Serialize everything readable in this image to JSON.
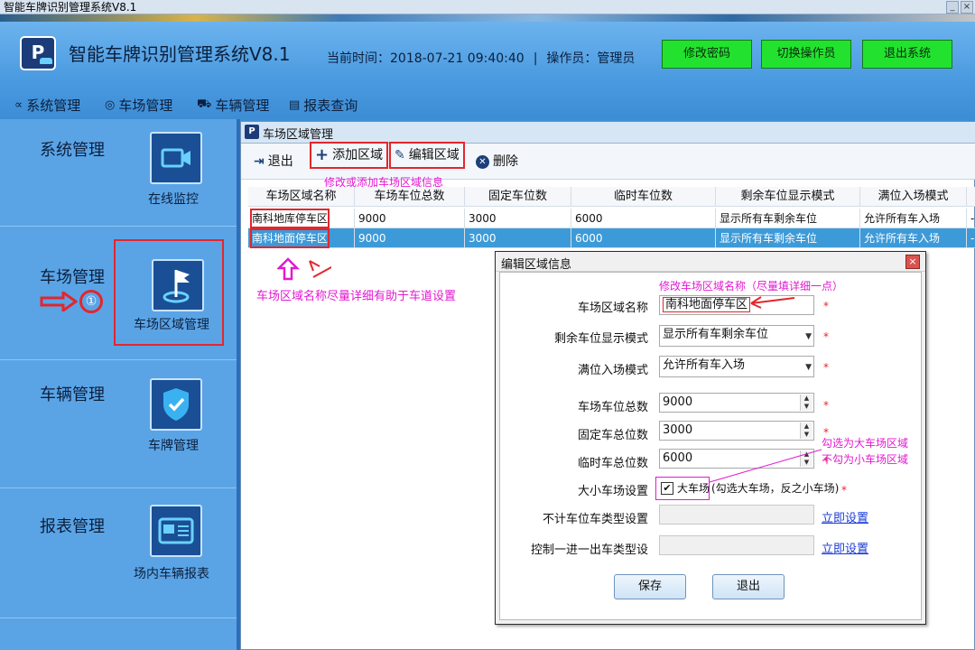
{
  "os_title": "智能车牌识别管理系统V8.1",
  "header": {
    "logo_letter": "P",
    "app_title": "智能车牌识别管理系统V8.1",
    "time_label": "当前时间：2018-07-21 09:40:40",
    "operator_label": "操作员：管理员",
    "sep": "|",
    "buttons": {
      "change_pwd": "修改密码",
      "switch_op": "切换操作员",
      "exit": "退出系统"
    }
  },
  "menu": [
    {
      "label": "系统管理",
      "icon": "share-icon",
      "glyph": "∝"
    },
    {
      "label": "车场管理",
      "icon": "parking-icon",
      "glyph": "◎"
    },
    {
      "label": "车辆管理",
      "icon": "car-icon",
      "glyph": "⛟"
    },
    {
      "label": "报表查询",
      "icon": "report-icon",
      "glyph": "▤"
    }
  ],
  "sidebar": {
    "sections": [
      {
        "label": "系统管理",
        "tile_caption": "在线监控",
        "icon": "camera-icon"
      },
      {
        "label": "车场管理",
        "tile_caption": "车场区域管理",
        "icon": "flag-icon"
      },
      {
        "label": "车辆管理",
        "tile_caption": "车牌管理",
        "icon": "shield-check-icon"
      },
      {
        "label": "报表管理",
        "tile_caption": "场内车辆报表",
        "icon": "id-card-icon"
      }
    ],
    "marker": "①"
  },
  "park_dialog": {
    "title": "车场区域管理",
    "title_icon": "P",
    "toolbar": {
      "exit": "退出",
      "add": "添加区域",
      "edit": "编辑区域",
      "delete": "删除"
    },
    "toolbar_hint": "修改或添加车场区域信息",
    "columns": [
      "车场区域名称",
      "车场车位总数",
      "固定车位数",
      "临时车位数",
      "剩余车位显示模式",
      "满位入场模式"
    ],
    "rows": [
      [
        "南科地库停车区",
        "9000",
        "3000",
        "6000",
        "显示所有车剩余车位",
        "允许所有车入场"
      ],
      [
        "南科地面停车区",
        "9000",
        "3000",
        "6000",
        "显示所有车剩余车位",
        "允许所有车入场"
      ]
    ],
    "selected_row": 1,
    "row_trailing": "-",
    "name_hint": "车场区域名称尽量详细有助于车道设置"
  },
  "edit_dialog": {
    "title": "编辑区域信息",
    "close": "×",
    "name_hint": "修改车场区域名称（尽量填详细一点）",
    "fields": {
      "name": {
        "label": "车场区域名称",
        "value": "南科地面停车区"
      },
      "remain_mode": {
        "label": "剩余车位显示模式",
        "value": "显示所有车剩余车位"
      },
      "full_mode": {
        "label": "满位入场模式",
        "value": "允许所有车入场"
      },
      "total": {
        "label": "车场车位总数",
        "value": "9000"
      },
      "fixed": {
        "label": "固定车总位数",
        "value": "3000"
      },
      "temp": {
        "label": "临时车总位数",
        "value": "6000"
      },
      "size": {
        "label": "大小车场设置",
        "checkbox_label": "大车场",
        "note": "(勾选大车场，反之小车场)",
        "checked": true
      },
      "exclude_types": {
        "label": "不计车位车类型设置",
        "link": "立即设置"
      },
      "one_in_out": {
        "label": "控制一进一出车类型设",
        "link": "立即设置"
      }
    },
    "required_mark": "*",
    "size_hint_1": "勾选为大车场区域",
    "size_hint_2": "不勾为小车场区域",
    "save": "保存",
    "exit": "退出"
  },
  "colors": {
    "accent": "#3d9ad8",
    "green_button": "#22e22f",
    "annotation": "#e21ad0",
    "highlight": "#e3262c"
  }
}
